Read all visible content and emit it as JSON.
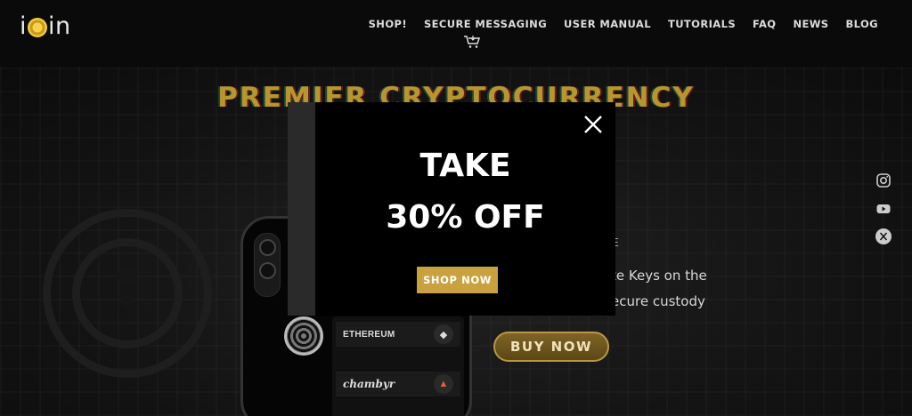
{
  "header": {
    "logo_text_start": "i",
    "logo_text_end": "in",
    "nav": [
      "SHOP!",
      "SECURE MESSAGING",
      "USER MANUAL",
      "TUTORIALS",
      "FAQ",
      "NEWS",
      "BLOG"
    ]
  },
  "hero": {
    "title": "PREMIER CRYPTOCURRENCY",
    "tagline_1": "te Keys on the",
    "tagline_2": "ecure custody",
    "stray_char": "E",
    "buy_label": "BUY NOW",
    "phone_rows": [
      {
        "label": "ETHEREUM",
        "icon": "ethereum-icon"
      },
      {
        "label": "chambyr",
        "icon": "torch-icon"
      }
    ]
  },
  "social": [
    "instagram-icon",
    "youtube-icon",
    "x-icon"
  ],
  "modal": {
    "line1": "TAKE",
    "line2": "30% OFF",
    "cta": "SHOP NOW"
  },
  "colors": {
    "gold": "#c9a13e",
    "title_gold": "#b8962e",
    "background": "#0b0b0b"
  }
}
